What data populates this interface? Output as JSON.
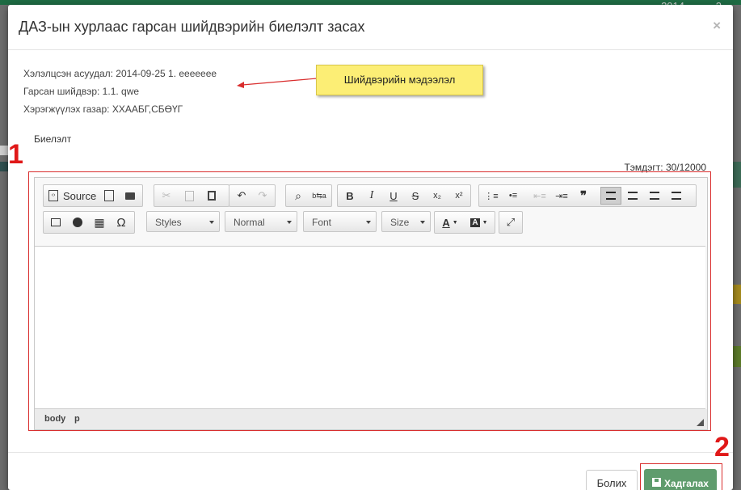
{
  "background": {
    "year": "2014",
    "page_num": "2",
    "top_bar_color": "#1e6b43"
  },
  "modal": {
    "title": "ДАЗ-ын хурлаас гарсан шийдвэрийн биелэлт засах",
    "close_label": "×",
    "info": {
      "question": "Хэлэлцсэн асуудал: 2014-09-25 1. eeeeeee",
      "decision": "Гарсан шийдвэр: 1.1. qwe",
      "responsible": "Хэрэгжүүлэх газар: ХХААБГ,СБӨҮГ"
    },
    "callout": "Шийдвэрийн мэдээлэл",
    "field_label": "Биелэлт",
    "counter": "Тэмдэгт: 30/12000",
    "annotations": [
      "1",
      "2"
    ],
    "annotation_color": "#e01818"
  },
  "editor": {
    "source_label": "Source",
    "combos": {
      "styles": "Styles",
      "format": "Normal",
      "font": "Font",
      "size": "Size"
    },
    "icons": [
      "source-icon",
      "preview-icon",
      "print-icon",
      "cut-icon",
      "copy-icon",
      "paste-icon",
      "undo-icon",
      "redo-icon",
      "find-icon",
      "replace-icon",
      "bold-icon",
      "italic-icon",
      "underline-icon",
      "strikethrough-icon",
      "subscript-icon",
      "superscript-icon",
      "numbered-list-icon",
      "bulleted-list-icon",
      "outdent-icon",
      "indent-icon",
      "blockquote-icon",
      "align-left-icon",
      "align-center-icon",
      "align-right-icon",
      "justify-icon",
      "image-icon",
      "flash-icon",
      "table-icon",
      "special-char-icon",
      "text-color-icon",
      "bg-color-icon",
      "maximize-icon"
    ],
    "glyphs": {
      "bold": "B",
      "italic": "I",
      "underline": "U",
      "strike": "S",
      "sub": "x₂",
      "sup": "x²",
      "special": "Ω",
      "quote": "❞",
      "text_color": "A",
      "bg_color": "A"
    },
    "path": [
      "body",
      "p"
    ]
  },
  "footer": {
    "cancel": "Болих",
    "save": "Хадгалах",
    "save_color": "#5f9c6d"
  }
}
